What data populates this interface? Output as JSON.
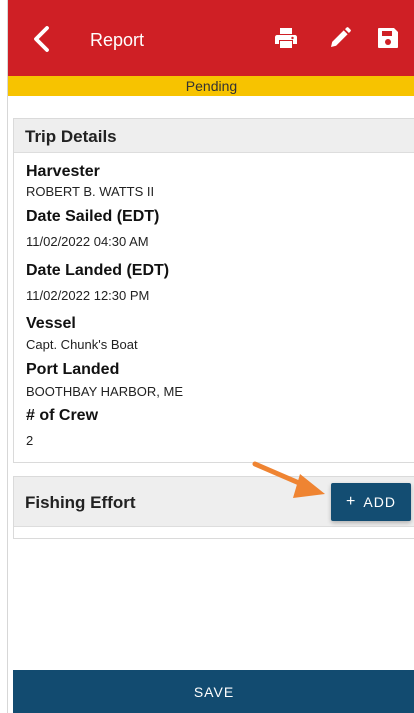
{
  "header": {
    "title": "Report",
    "back_icon": "chevron-left-icon",
    "actions": [
      "printer-icon",
      "pencil-icon",
      "save-disk-icon"
    ],
    "background_color": "#cf1f25"
  },
  "status": {
    "text": "Pending",
    "background_color": "#f7c300"
  },
  "trip_details": {
    "title": "Trip Details",
    "fields": [
      {
        "label": "Harvester",
        "value": "ROBERT B. WATTS II"
      },
      {
        "label": "Date Sailed (EDT)",
        "value": "11/02/2022 04:30 AM"
      },
      {
        "label": "Date Landed (EDT)",
        "value": "11/02/2022 12:30 PM"
      },
      {
        "label": "Vessel",
        "value": "Capt. Chunk's Boat"
      },
      {
        "label": "Port Landed",
        "value": "BOOTHBAY HARBOR, ME"
      },
      {
        "label": "# of Crew",
        "value": "2"
      }
    ]
  },
  "fishing_effort": {
    "title": "Fishing Effort",
    "add_label": "ADD",
    "add_icon": "plus-icon",
    "button_color": "#134d72"
  },
  "footer": {
    "save_label": "SAVE",
    "button_color": "#124b70"
  },
  "annotation": {
    "arrow_icon": "arrow-right-icon",
    "color": "#ef8432"
  }
}
